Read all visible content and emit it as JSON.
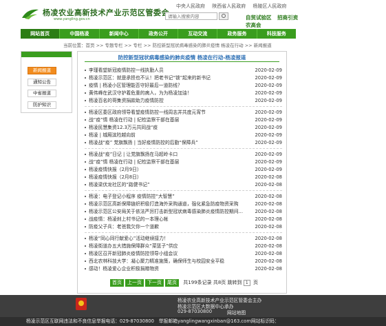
{
  "header": {
    "site_title": "杨凌农业高新技术产业示范区管委会",
    "site_url": "www.yangling.gov.cn",
    "top_links": [
      "中央人民政府",
      "陕西省人民政府",
      "杨陵区人民政府"
    ],
    "search_placeholder": "请输入搜索内容",
    "quick_links": [
      "自贸试验区",
      "招商引资"
    ],
    "quick_link_3": "农高会"
  },
  "nav": {
    "items": [
      "网站首页",
      "中国杨凌",
      "新闻中心",
      "政务公开",
      "互动交流",
      "政务服务",
      "科技服务"
    ]
  },
  "breadcrumb": "当前位置：首页 >> 专题专栏 >> 专栏 >> 防控新型冠状病毒感染的肺炎疫情 杨凌在行动 >> 新闻报道",
  "sidebar": {
    "items": [
      "新闻报道",
      "通知公告",
      "中省报道",
      "防护知识"
    ]
  },
  "main": {
    "title": "防控新型冠状病毒感染的肺炎疫情 杨凌在行动-杨凌报道",
    "groups": [
      [
        {
          "title": "李瑾看望新冠疫情防控一线执勤人员",
          "date": "2020-02-09"
        },
        {
          "title": "杨凌示范区：就是承担也不认！把老书记“锁”起来的新书记",
          "date": "2020-02-09"
        },
        {
          "title": "疫情 | 杨凌小区管理能否守好最后一道防线？",
          "date": "2020-02-09"
        },
        {
          "title": "黄伟峰在武汉守护着危重的病人，为为杨凌加油！",
          "date": "2020-02-09"
        },
        {
          "title": "杨凌百名的哥集资捐款助力疫情防控",
          "date": "2020-02-09"
        }
      ],
      [
        {
          "title": "杨凌区委区政府领导看望疫情防控一线周志并共度元宵节",
          "date": "2020-02-09"
        },
        {
          "title": "战“疫”情 杨凌在行动 | 纪检监察干部在基层",
          "date": "2020-02-09"
        },
        {
          "title": "杨凌民慧集资12.3万元共同战“疫",
          "date": "2020-02-09"
        },
        {
          "title": "杨凌 | 城厢滨险越向前",
          "date": "2020-02-09"
        },
        {
          "title": "杨凌战“疫” 党旗飘扬 | 当好疫情防控的后勤“保障兵”",
          "date": "2020-02-09"
        }
      ],
      [
        {
          "title": "杨凌战“疫”日记 | 让党旗飘扬在马超岭卡口",
          "date": "2020-02-09"
        },
        {
          "title": "战“疫”情 杨凌在行动 | 纪检监察干部在基层",
          "date": "2020-02-09"
        },
        {
          "title": "杨凌疫情快报（2月9日）",
          "date": "2020-02-09"
        },
        {
          "title": "杨凌疫情快报（2月8日）",
          "date": "2020-02-08"
        },
        {
          "title": "杨凌梁伏龙社区的“路健书记”",
          "date": "2020-02-08"
        }
      ],
      [
        {
          "title": "杨凌：电子登记小程序 疫情防控“大智慧”",
          "date": "2020-02-08"
        },
        {
          "title": "杨凌示范区高新保障链织积极打造海外采购通道，强化紧急防疫物资采购",
          "date": "2020-02-08"
        },
        {
          "title": "杨凌示范区公安局关于依法严厉打击新型冠状病毒感染肺炎疫情防控期间...",
          "date": "2020-02-08"
        },
        {
          "title": "战疫情：杨凌刹上村书记的一本理心帐",
          "date": "2020-02-08"
        },
        {
          "title": "防疫父子兵：老爸我欠你一个道歉",
          "date": "2020-02-08"
        }
      ],
      [
        {
          "title": "杨凌“同心同行献爱心”活动继续接力！",
          "date": "2020-02-08"
        },
        {
          "title": "杨凌街道办五大措施保障群众“菜篮子”供应",
          "date": "2020-02-08"
        },
        {
          "title": "杨凌区召开新冠肺炎疫情防控领导小组会议",
          "date": "2020-02-08"
        },
        {
          "title": "西北农林科技大学：凝心聚力精准施策，确保师生与校园安全平稳",
          "date": "2020-02-08"
        },
        {
          "title": "感动！杨凌爱心企业积极捐赠物资",
          "date": "2020-02-08"
        }
      ]
    ]
  },
  "pager": {
    "first": "首页",
    "prev": "上一页",
    "next": "下一页",
    "last": "尾页",
    "summary": "共199条记录 共8页 跳转到",
    "page_input": "1",
    "page_suffix": "页"
  },
  "footer": {
    "line1": "杨凌农业高新技术产业示范区管委会主办",
    "line2": "杨凌示范区大数据中心承办",
    "line3": "029-87030800",
    "map_link": "网站地图",
    "bottom": "杨凌示范区互联网违法和不良信息举报电话：029-87030800　举报邮箱yanglingwangxinban@163.com网站标识码："
  },
  "colors": {
    "brand_green": "#3a9d1e",
    "active_orange": "#f28c1e",
    "title_blue": "#2c6fb5",
    "footer_bg": "#3e3e3e"
  }
}
